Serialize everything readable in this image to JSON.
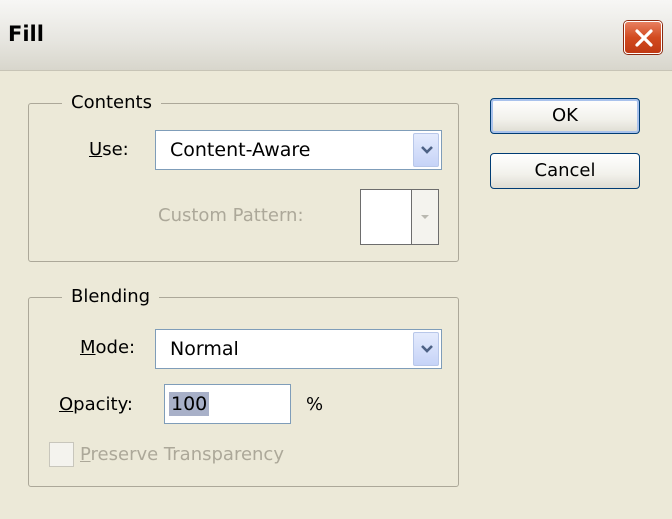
{
  "window": {
    "title": "Fill"
  },
  "contents_group": {
    "legend": "Contents",
    "use_label_underlined": "U",
    "use_label_rest": "se:",
    "use_value": "Content-Aware",
    "custom_pattern_label": "Custom Pattern:"
  },
  "blending_group": {
    "legend": "Blending",
    "mode_label_underlined": "M",
    "mode_label_rest": "ode:",
    "mode_value": "Normal",
    "opacity_label_underlined": "O",
    "opacity_label_rest": "pacity:",
    "opacity_value": "100",
    "opacity_unit": "%",
    "preserve_underlined": "P",
    "preserve_rest": "reserve Transparency",
    "preserve_checked": false
  },
  "buttons": {
    "ok": "OK",
    "cancel": "Cancel"
  },
  "colors": {
    "dialog_bg": "#ece9d8",
    "close_button": "#d24a20",
    "disabled_text": "#aca899",
    "selection_highlight": "#a8b0c8"
  },
  "icons": {
    "close": "close-icon",
    "dropdown": "chevron-down-icon"
  }
}
